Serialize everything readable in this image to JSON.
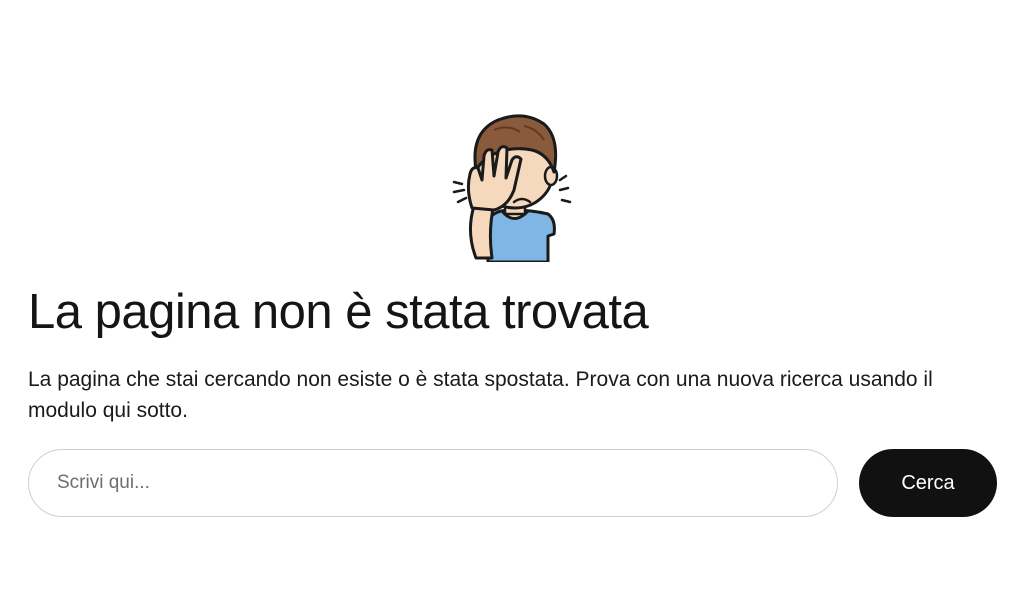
{
  "error": {
    "illustration": "facepalm-boy-icon",
    "title": "La pagina non è stata trovata",
    "description": "La pagina che stai cercando non esiste o è stata spostata. Prova con una nuova ricerca usando il modulo qui sotto."
  },
  "search": {
    "placeholder": "Scrivi qui...",
    "value": "",
    "button_label": "Cerca"
  },
  "colors": {
    "button_bg": "#111111",
    "button_text": "#ffffff",
    "input_border": "#cfcfcf",
    "text": "#151515"
  }
}
